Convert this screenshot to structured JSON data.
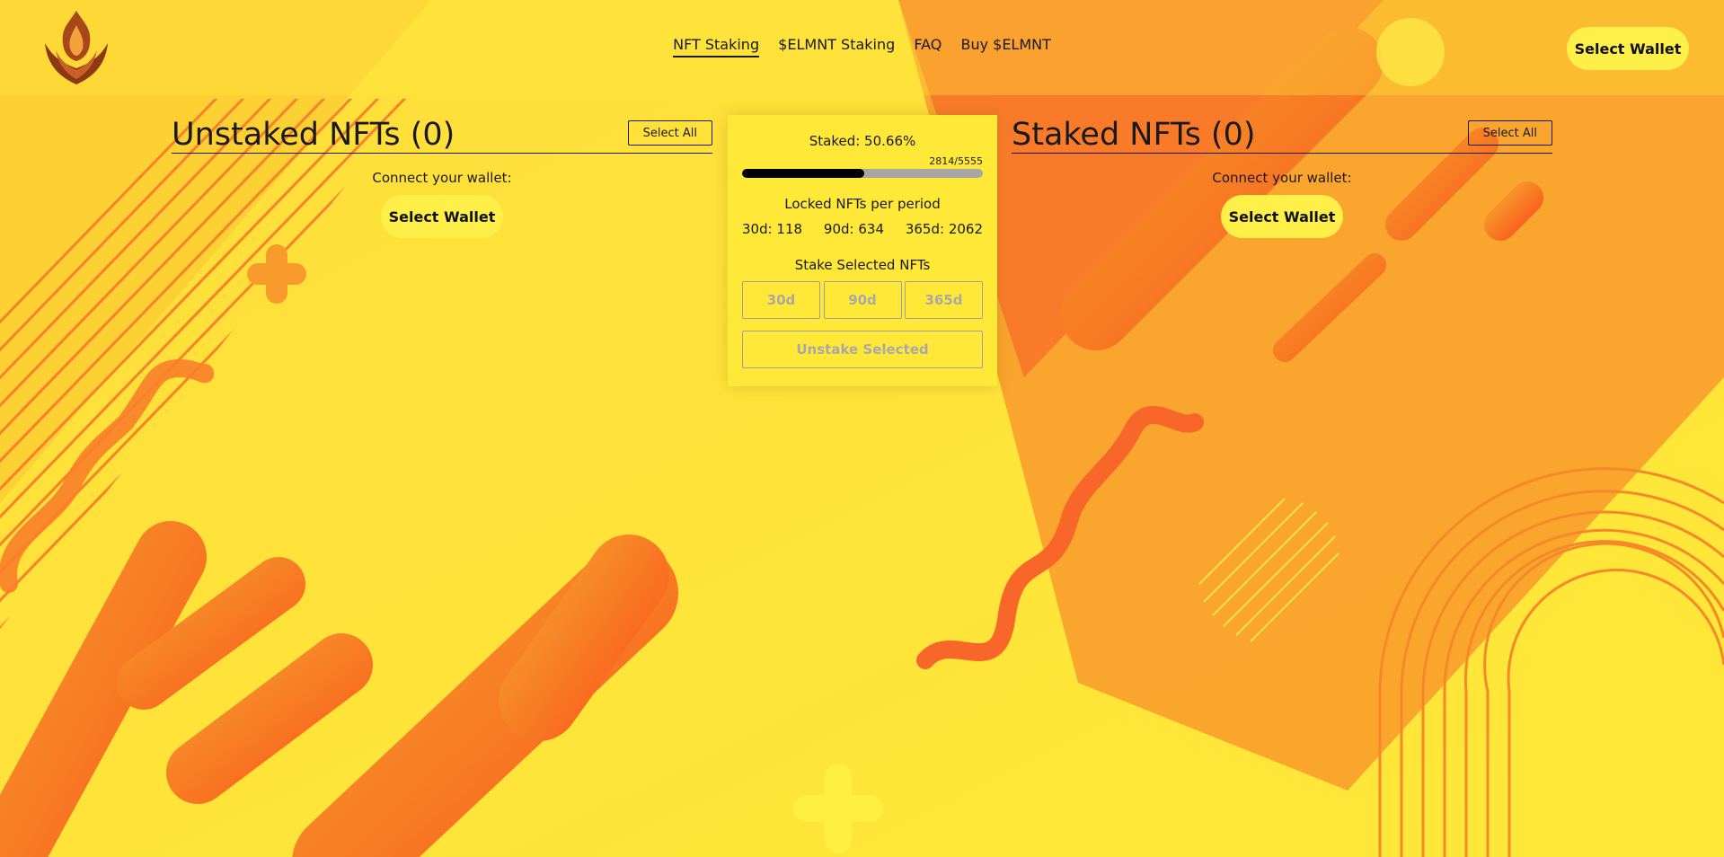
{
  "nav": {
    "items": [
      {
        "label": "NFT Staking",
        "active": true
      },
      {
        "label": "$ELMNT Staking",
        "active": false
      },
      {
        "label": "FAQ",
        "active": false
      },
      {
        "label": "Buy $ELMNT",
        "active": false
      }
    ]
  },
  "header": {
    "wallet_button": "Select Wallet",
    "logo_icon": "flame-logo-icon"
  },
  "unstaked": {
    "title": "Unstaked NFTs (0)",
    "select_all": "Select All",
    "connect_label": "Connect your wallet:",
    "wallet_button": "Select Wallet"
  },
  "staked": {
    "title": "Staked NFTs (0)",
    "select_all": "Select All",
    "connect_label": "Connect your wallet:",
    "wallet_button": "Select Wallet"
  },
  "stake_card": {
    "staked_label": "Staked: 50.66%",
    "progress_fraction": 0.5066,
    "count": "2814/5555",
    "locked_title": "Locked NFTs per period",
    "locked": [
      "30d: 118",
      "90d: 634",
      "365d: 2062"
    ],
    "stake_title": "Stake Selected NFTs",
    "periods": [
      "30d",
      "90d",
      "365d"
    ],
    "unstake_button": "Unstake Selected"
  },
  "colors": {
    "background": "#ffe838",
    "accent_orange": "#f7722a",
    "progress_fill": "#000000",
    "progress_track": "#a6a6a6",
    "disabled_text": "#a8a8a8"
  }
}
